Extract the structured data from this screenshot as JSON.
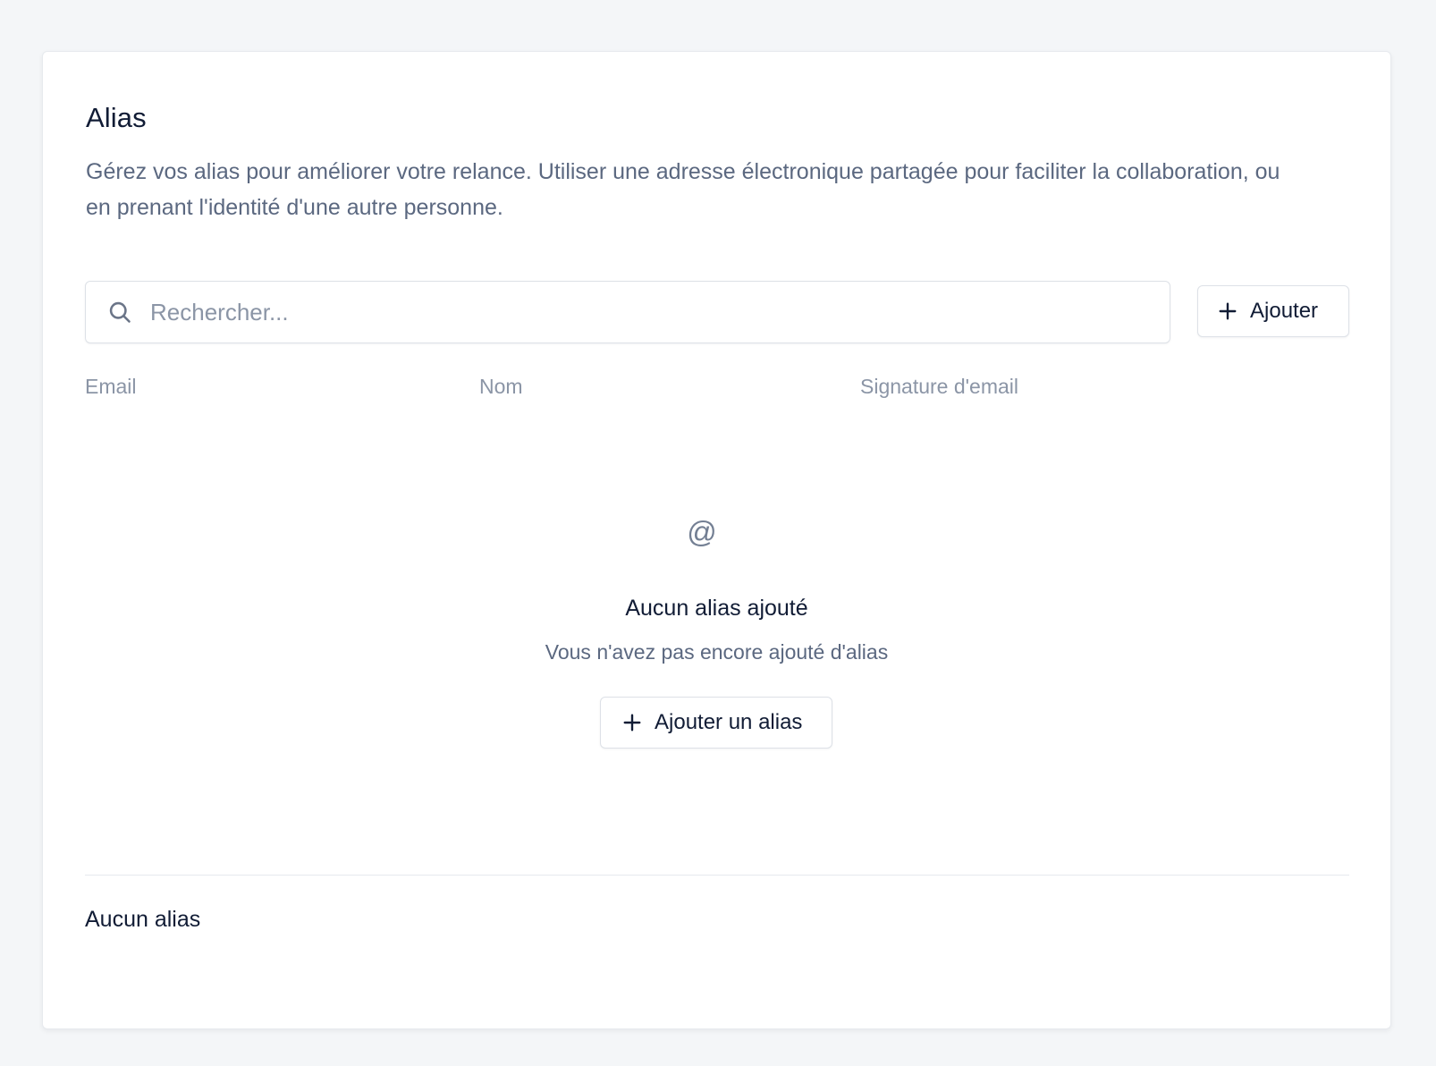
{
  "header": {
    "title": "Alias",
    "description": "Gérez vos alias pour améliorer votre relance. Utiliser une adresse électronique partagée pour faciliter la collaboration, ou en prenant l'identité d'une autre personne."
  },
  "search": {
    "placeholder": "Rechercher...",
    "value": "",
    "icon": "search-icon"
  },
  "toolbar": {
    "add_label": "Ajouter",
    "add_icon": "plus-icon"
  },
  "table": {
    "columns": [
      "Email",
      "Nom",
      "Signature d'email"
    ],
    "rows": []
  },
  "empty_state": {
    "icon": "at-icon",
    "icon_glyph": "@",
    "title": "Aucun alias ajouté",
    "subtitle": "Vous n'avez pas encore ajouté d'alias",
    "button_label": "Ajouter un alias",
    "button_icon": "plus-icon"
  },
  "footer": {
    "summary": "Aucun alias"
  },
  "colors": {
    "background": "#f4f6f8",
    "card": "#ffffff",
    "text_primary": "#111c35",
    "text_secondary": "#5b6880",
    "text_muted": "#8b95a6",
    "border": "#dde1e7"
  }
}
